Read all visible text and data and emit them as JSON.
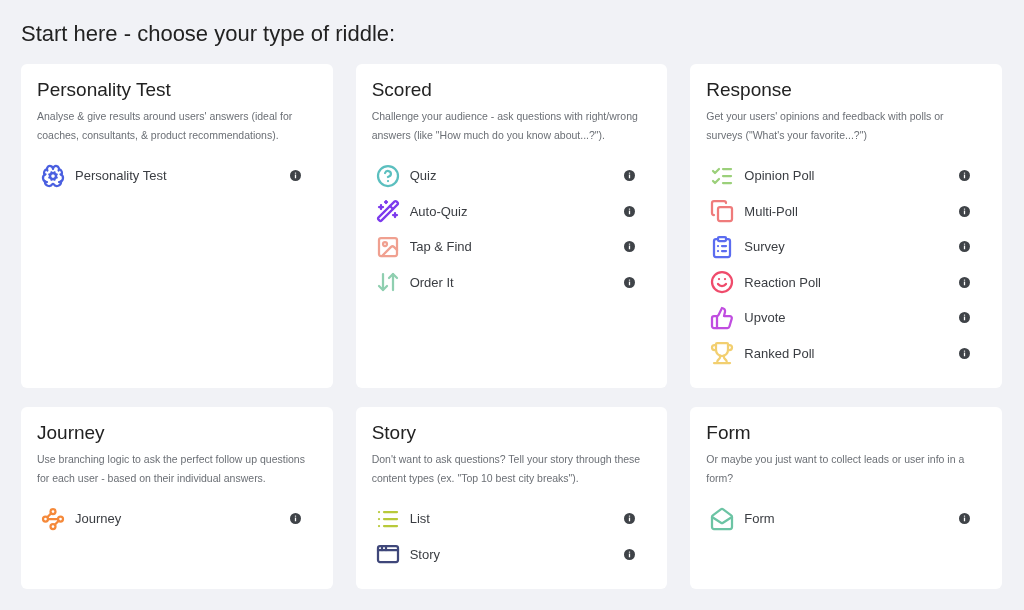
{
  "heading": "Start here - choose your type of riddle:",
  "cards": [
    {
      "title": "Personality Test",
      "description": "Analyse & give results around users' answers (ideal for coaches, consultants, & product recommendations).",
      "items": [
        {
          "label": "Personality Test",
          "kind": "personality",
          "color": "#4a5fe0"
        }
      ]
    },
    {
      "title": "Scored",
      "description": "Challenge your audience - ask questions with right/wrong answers (like \"How much do you know about...?\").",
      "items": [
        {
          "label": "Quiz",
          "kind": "quiz",
          "color": "#5bbfbf"
        },
        {
          "label": "Auto-Quiz",
          "kind": "autoquiz",
          "color": "#7c3aed"
        },
        {
          "label": "Tap & Find",
          "kind": "tapfind",
          "color": "#f0a090"
        },
        {
          "label": "Order It",
          "kind": "orderit",
          "color": "#8fcfb0"
        }
      ]
    },
    {
      "title": "Response",
      "description": "Get your users' opinions and feedback with polls or surveys (\"What's your favorite...?\")",
      "items": [
        {
          "label": "Opinion Poll",
          "kind": "opinion",
          "color": "#9bd07a"
        },
        {
          "label": "Multi-Poll",
          "kind": "multipoll",
          "color": "#ef7b7b"
        },
        {
          "label": "Survey",
          "kind": "survey",
          "color": "#5b6cf0"
        },
        {
          "label": "Reaction Poll",
          "kind": "reaction",
          "color": "#ef4b6b"
        },
        {
          "label": "Upvote",
          "kind": "upvote",
          "color": "#c04de0"
        },
        {
          "label": "Ranked Poll",
          "kind": "ranked",
          "color": "#f2cf70"
        }
      ]
    },
    {
      "title": "Journey",
      "description": "Use branching logic to ask the perfect follow up questions for each user - based on their individual answers.",
      "items": [
        {
          "label": "Journey",
          "kind": "journey",
          "color": "#f5893a"
        }
      ]
    },
    {
      "title": "Story",
      "description": "Don't want to ask questions? Tell your story through these content types (ex. \"Top 10 best city breaks\").",
      "items": [
        {
          "label": "List",
          "kind": "list",
          "color": "#b8c93a"
        },
        {
          "label": "Story",
          "kind": "story",
          "color": "#3f477a"
        }
      ]
    },
    {
      "title": "Form",
      "description": "Or maybe you just want to collect leads or user info in a form?",
      "items": [
        {
          "label": "Form",
          "kind": "form",
          "color": "#6cc4a4"
        }
      ]
    }
  ]
}
